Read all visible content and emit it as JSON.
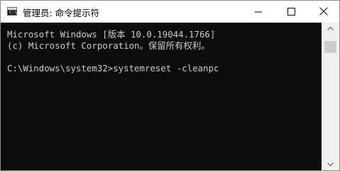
{
  "window": {
    "title": "管理员: 命令提示符",
    "icon": "cmd-icon",
    "icon_prompt": "C:\\"
  },
  "controls": {
    "minimize": "minimize-icon",
    "maximize": "maximize-icon",
    "close": "close-icon"
  },
  "console": {
    "lines": [
      "Microsoft Windows [版本 10.0.19044.1766]",
      "(c) Microsoft Corporation。保留所有权利。",
      "",
      "C:\\Windows\\system32>systemreset -cleanpc"
    ],
    "background": "#0c0c0c",
    "text_color": "#cccccc"
  }
}
